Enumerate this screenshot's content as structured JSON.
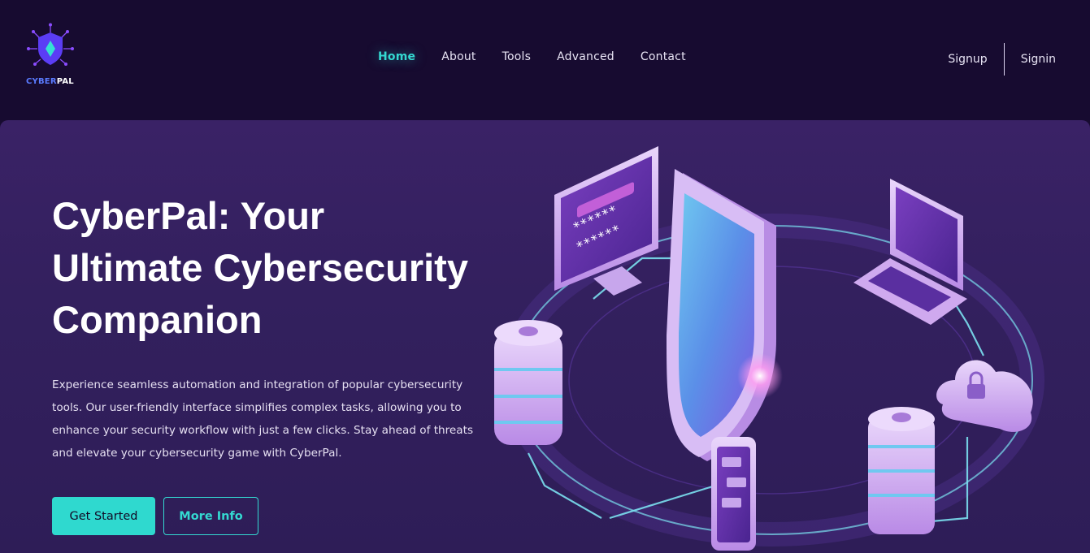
{
  "brand": {
    "name_part1": "CYBER",
    "name_part2": "PAL",
    "logo_icon": "shield-network-icon",
    "colors": {
      "accent": "#34d9d1",
      "logo_blue": "#5a7bff",
      "shield": "#5b3df5"
    }
  },
  "nav": {
    "items": [
      {
        "label": "Home",
        "active": true
      },
      {
        "label": "About",
        "active": false
      },
      {
        "label": "Tools",
        "active": false
      },
      {
        "label": "Advanced",
        "active": false
      },
      {
        "label": "Contact",
        "active": false
      }
    ]
  },
  "auth": {
    "signup_label": "Signup",
    "signin_label": "Signin"
  },
  "hero": {
    "title_line1": "CyberPal: Your",
    "title_line2": "Ultimate Cybersecurity",
    "title_line3": "Companion",
    "description": "Experience seamless automation and integration of popular cybersecurity tools. Our user-friendly interface simplifies complex tasks, allowing you to enhance your security workflow with just a few clicks. Stay ahead of threats and elevate your cybersecurity game with CyberPal.",
    "primary_button": "Get Started",
    "secondary_button": "More Info",
    "monitor_password_mask_1": "******",
    "monitor_password_mask_2": "******"
  },
  "colors": {
    "header_bg": "#170b30",
    "hero_bg": "#33205e",
    "accent_teal": "#34d9d1",
    "illustration_lilac": "#d7b8f2"
  }
}
